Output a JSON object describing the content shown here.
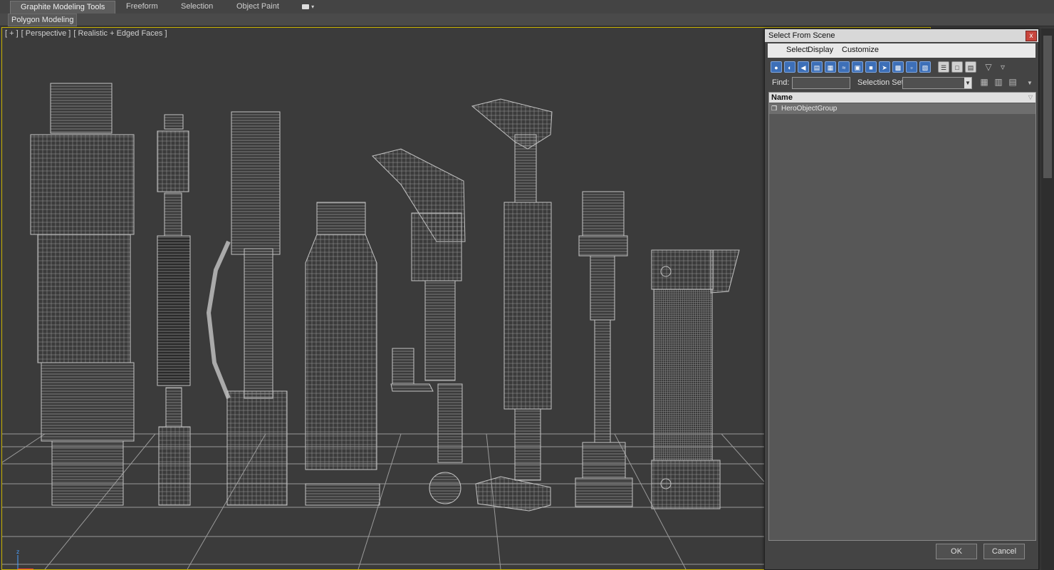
{
  "ribbon": {
    "tabs": [
      {
        "label": "Graphite Modeling Tools",
        "active": true
      },
      {
        "label": "Freeform",
        "active": false
      },
      {
        "label": "Selection",
        "active": false
      },
      {
        "label": "Object Paint",
        "active": false
      }
    ],
    "extra_icon": "dropdown-toggle-icon",
    "sub_panel": "Polygon Modeling"
  },
  "viewport": {
    "labels": [
      "[ + ]",
      "[ Perspective ]",
      "[ Realistic + Edged Faces ]"
    ]
  },
  "dialog": {
    "title": "Select From Scene",
    "close_glyph": "x",
    "menu": [
      "Select",
      "Display",
      "Customize"
    ],
    "find_label": "Find:",
    "find_value": "",
    "selection_set_label": "Selection Set:",
    "selection_set_value": "",
    "column_header": "Name",
    "items": [
      {
        "name": "HeroObjectGroup",
        "icon": "group-icon",
        "selected": true
      }
    ],
    "ok_label": "OK",
    "cancel_label": "Cancel"
  },
  "colors": {
    "viewport_border": "#c8b200",
    "toolbar_icon": "#3d6fb7",
    "close_button": "#c9463d"
  }
}
